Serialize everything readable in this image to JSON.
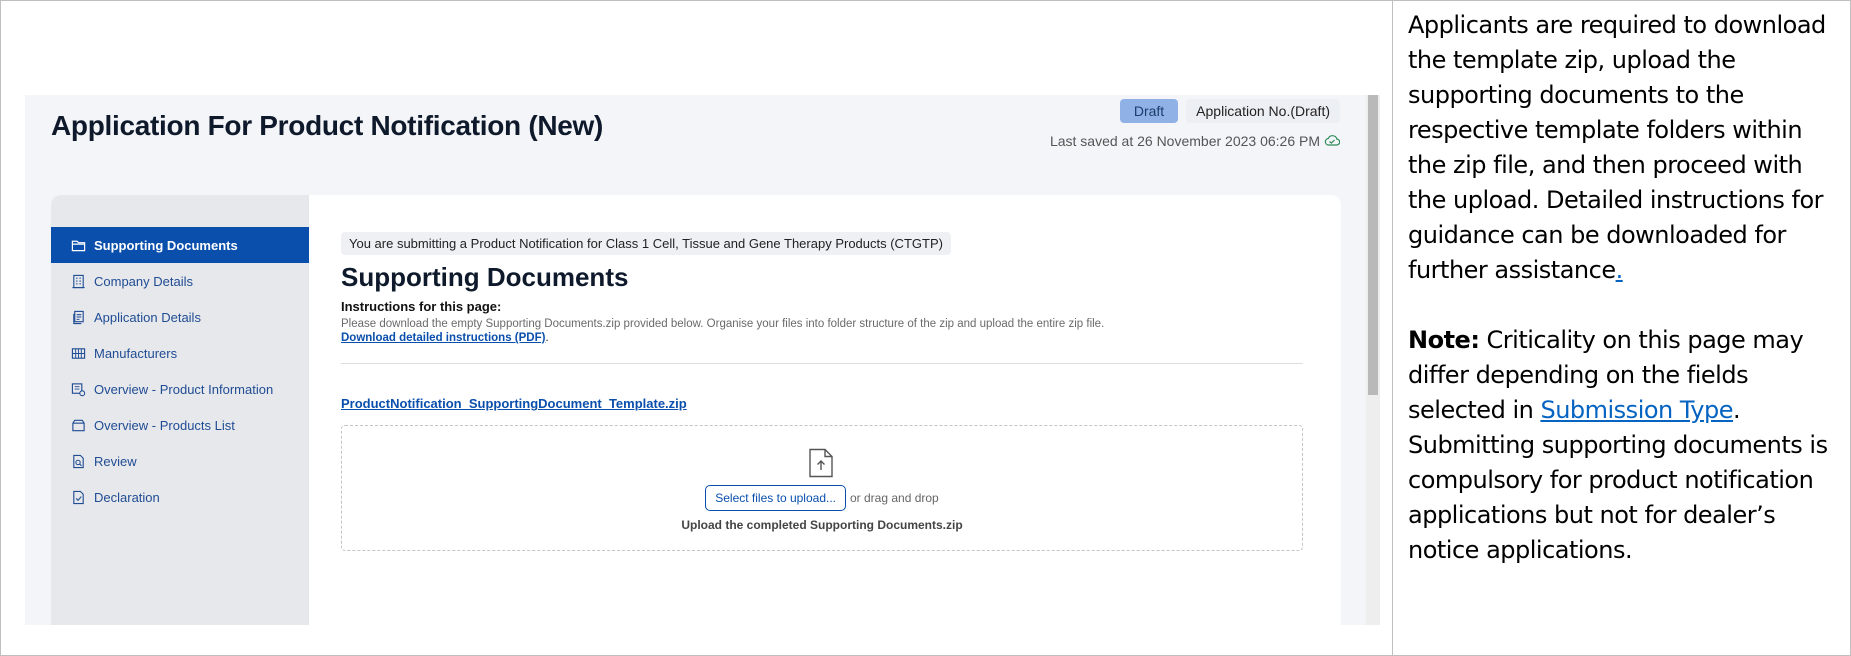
{
  "app": {
    "title": "Application For Product Notification (New)",
    "status_badge": "Draft",
    "application_no": "Application No.(Draft)",
    "last_saved": "Last saved at 26 November 2023 06:26 PM"
  },
  "sidebar": {
    "items": [
      {
        "label": "Supporting Documents",
        "icon": "folder-icon",
        "active": true
      },
      {
        "label": "Company Details",
        "icon": "building-icon",
        "active": false
      },
      {
        "label": "Application Details",
        "icon": "documents-icon",
        "active": false
      },
      {
        "label": "Manufacturers",
        "icon": "factory-icon",
        "active": false
      },
      {
        "label": "Overview - Product Information",
        "icon": "product-info-icon",
        "active": false
      },
      {
        "label": "Overview - Products List",
        "icon": "box-icon",
        "active": false
      },
      {
        "label": "Review",
        "icon": "review-icon",
        "active": false
      },
      {
        "label": "Declaration",
        "icon": "declaration-icon",
        "active": false
      }
    ]
  },
  "content": {
    "info_pill": "You are submitting a Product Notification for Class 1 Cell, Tissue and Gene Therapy Products (CTGTP)",
    "section_title": "Supporting Documents",
    "instructions_heading": "Instructions for this page:",
    "instructions_text": "Please download the empty Supporting Documents.zip provided below. Organise your files into folder structure of the zip and upload the entire zip file.",
    "instructions_link": "Download detailed instructions (PDF)",
    "instructions_link_suffix": ".",
    "template_link": "ProductNotification_SupportingDocument_Template.zip",
    "upload_button": "Select files to upload...",
    "drag_text": "or drag and drop",
    "upload_hint": "Upload the completed Supporting Documents.zip"
  },
  "notes": {
    "p1_text": "Applicants are required to download the template zip, upload the supporting documents to the respective template folders within the zip file, and then proceed with the upload. Detailed instructions for guidance can be downloaded for further assistance",
    "p1_link": ".",
    "p2_label": "Note:",
    "p2_text_a": " Criticality on this page may differ depending on the fields selected in ",
    "p2_link": "Submission Type",
    "p2_text_b": ". Submitting supporting documents is compulsory for product notification applications but not for dealer’s notice applications."
  },
  "colors": {
    "primary": "#0b4fad",
    "draft_badge": "#8fb1e6",
    "sidebar_bg": "#e7e8ec",
    "link": "#0563c1"
  }
}
